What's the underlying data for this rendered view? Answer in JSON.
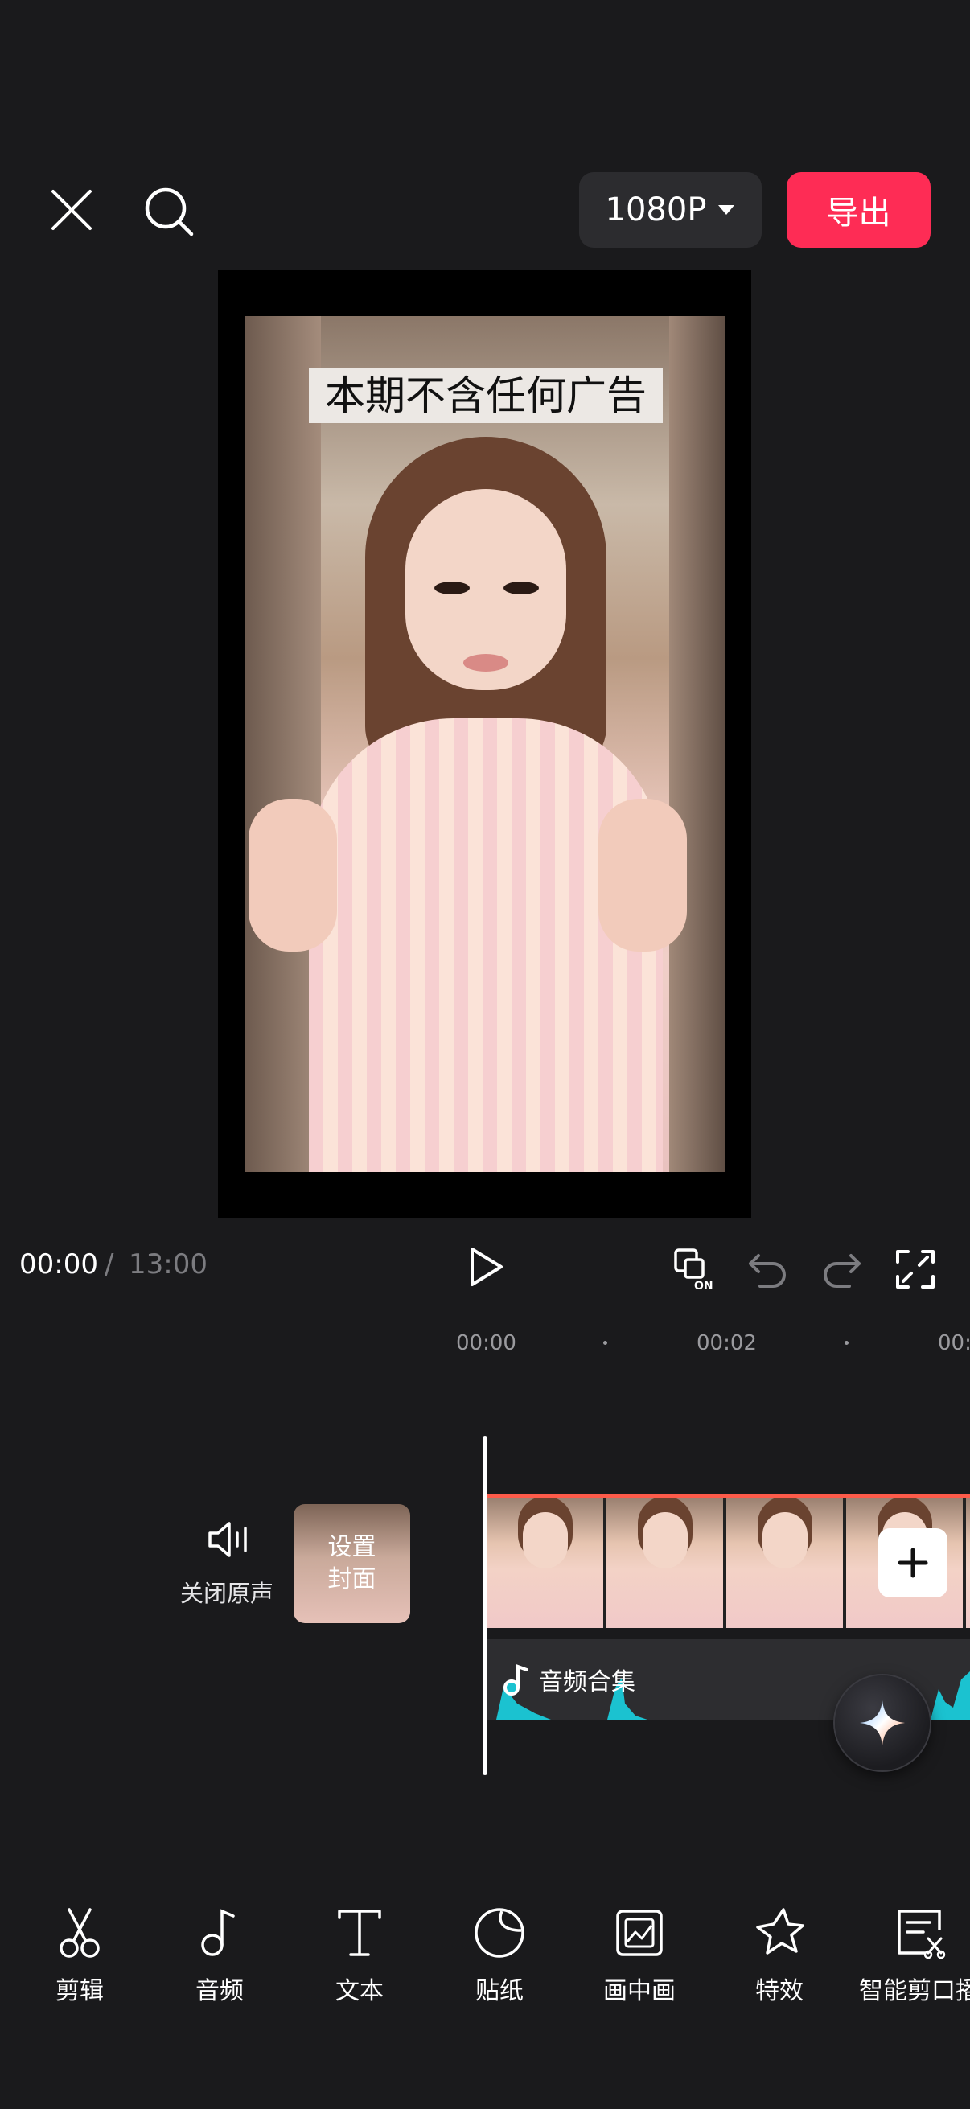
{
  "top_bar": {
    "resolution": "1080P",
    "export_label": "导出"
  },
  "preview": {
    "caption": "本期不含任何广告"
  },
  "playback": {
    "current_time": "00:00",
    "separator": "/",
    "total_time": "13:00"
  },
  "timeline": {
    "ruler": [
      "00:00",
      "00:02",
      "00:"
    ],
    "mute_label": "关闭原声",
    "cover_line1": "设置",
    "cover_line2": "封面",
    "audio_label": "音频合集"
  },
  "toolbar": {
    "items": [
      {
        "label": "剪辑",
        "icon": "scissors-icon"
      },
      {
        "label": "音频",
        "icon": "music-note-icon"
      },
      {
        "label": "文本",
        "icon": "text-icon"
      },
      {
        "label": "贴纸",
        "icon": "sticker-icon"
      },
      {
        "label": "画中画",
        "icon": "picture-in-picture-icon"
      },
      {
        "label": "特效",
        "icon": "effects-star-icon"
      },
      {
        "label": "智能剪口播",
        "icon": "smart-cut-icon"
      }
    ]
  },
  "colors": {
    "accent": "#fe2c55",
    "clip_border": "#fe5b4a",
    "waveform": "#1bc2d0"
  }
}
